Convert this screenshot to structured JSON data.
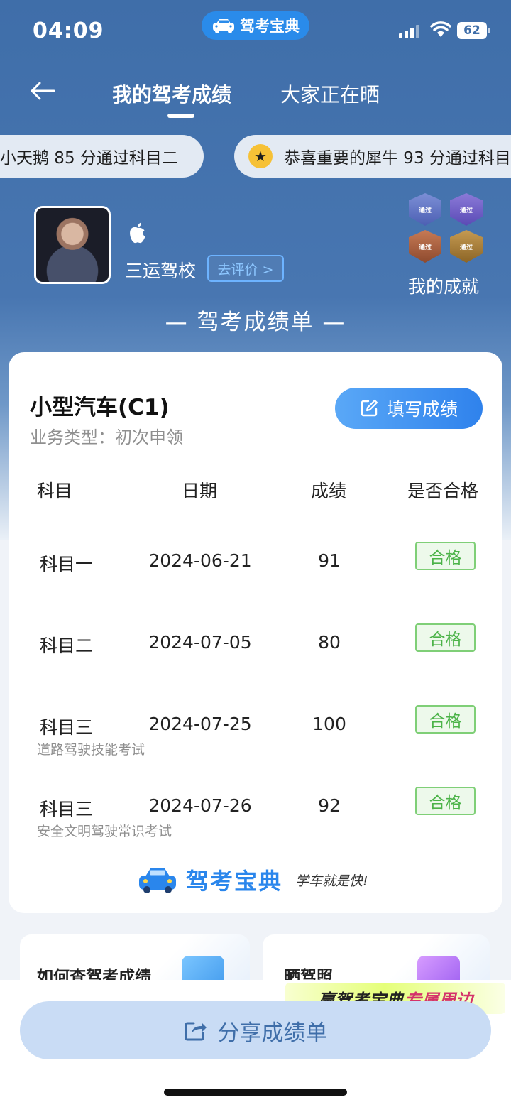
{
  "status_bar": {
    "time": "04:09",
    "app_name": "驾考宝典",
    "battery": "62"
  },
  "nav": {
    "tabs": [
      {
        "label": "我的驾考成绩",
        "active": true
      },
      {
        "label": "大家正在晒",
        "active": false
      }
    ]
  },
  "marquee": [
    "小天鹅 85 分通过科目二",
    "恭喜重要的犀牛 93 分通过科目"
  ],
  "profile": {
    "school": "三运驾校",
    "review_label": "去评价 >",
    "achievements_label": "我的成就",
    "badge_text": "通过"
  },
  "report_heading": "— 驾考成绩单 —",
  "card": {
    "vehicle": "小型汽车(C1)",
    "business_type": "业务类型：初次申领",
    "fill_button": "填写成绩",
    "headers": {
      "subject": "科目",
      "date": "日期",
      "score": "成绩",
      "pass": "是否合格"
    },
    "rows": [
      {
        "subject": "科目一",
        "date": "2024-06-21",
        "score": "91",
        "pass": "合格",
        "note": ""
      },
      {
        "subject": "科目二",
        "date": "2024-07-05",
        "score": "80",
        "pass": "合格",
        "note": ""
      },
      {
        "subject": "科目三",
        "date": "2024-07-25",
        "score": "100",
        "pass": "合格",
        "note": "道路驾驶技能考试"
      },
      {
        "subject": "科目三",
        "date": "2024-07-26",
        "score": "92",
        "pass": "合格",
        "note": "安全文明驾驶常识考试"
      }
    ],
    "logo_text": "驾考宝典",
    "slogan": "学车就是快!"
  },
  "promos": [
    {
      "title": "如何查驾考成绩"
    },
    {
      "title": "晒驾照"
    }
  ],
  "merch_banner": {
    "prefix": "赢驾考宝典",
    "accent": "专属周边"
  },
  "share_button": "分享成绩单",
  "colors": {
    "brand_blue": "#2a86ec",
    "hero_blue": "#3f6ea9",
    "pass_green": "#4bb348"
  }
}
